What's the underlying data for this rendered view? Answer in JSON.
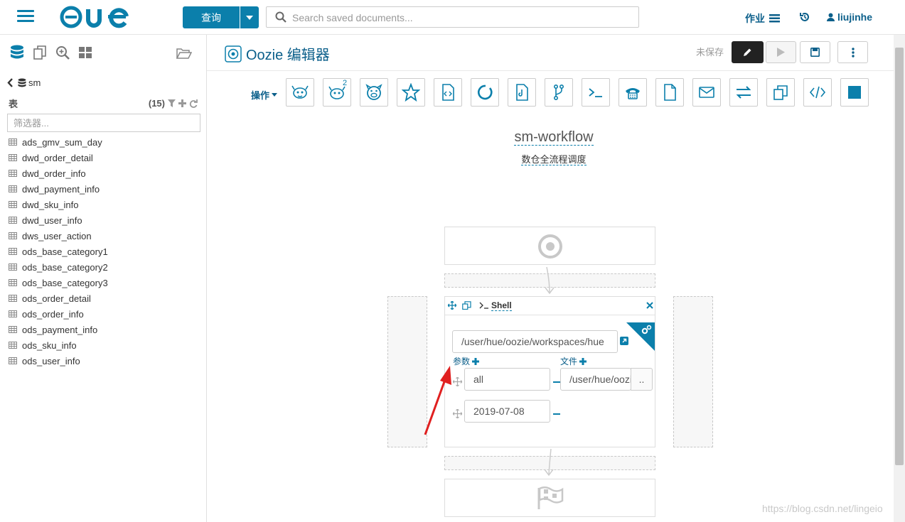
{
  "topbar": {
    "logo": "HUE",
    "query_button": "查询",
    "search_placeholder": "Search saved documents...",
    "jobs_label": "作业",
    "user": "liujinhe"
  },
  "left": {
    "db_name": "sm",
    "tables_label": "表",
    "table_count": "(15)",
    "filter_placeholder": "筛选器...",
    "tables": [
      "ads_gmv_sum_day",
      "dwd_order_detail",
      "dwd_order_info",
      "dwd_payment_info",
      "dwd_sku_info",
      "dwd_user_info",
      "dws_user_action",
      "ods_base_category1",
      "ods_base_category2",
      "ods_base_category3",
      "ods_order_detail",
      "ods_order_info",
      "ods_payment_info",
      "ods_sku_info",
      "ods_user_info"
    ]
  },
  "editor": {
    "title": "Oozie 编辑器",
    "unsaved": "未保存",
    "actions_label": "操作",
    "hive2_badge": "2",
    "workflow_name": "sm-workflow",
    "workflow_desc": "数仓全流程调度",
    "node": {
      "type_label": "Shell",
      "script_path": "/user/hue/oozie/workspaces/hue",
      "params_label": "参数",
      "files_label": "文件",
      "param1": "all",
      "param2": "2019-07-08",
      "file1": "/user/hue/oozie",
      "browse": ".."
    }
  },
  "watermark": "https://blog.csdn.net/lingeio",
  "colors": {
    "accent": "#0b7fab",
    "dark_button": "#222222",
    "arrow": "#e02020"
  }
}
